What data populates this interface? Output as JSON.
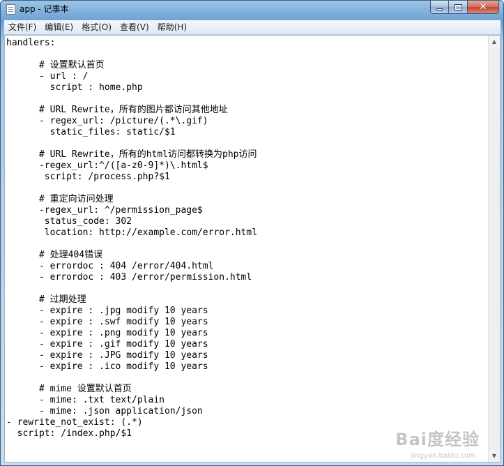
{
  "window": {
    "title": "app - 记事本",
    "icon": "notepad-icon",
    "controls": {
      "minimize": "minimize-icon",
      "maximize": "maximize-icon",
      "close": "close-icon"
    }
  },
  "menu": {
    "items": [
      {
        "label": "文件(F)"
      },
      {
        "label": "编辑(E)"
      },
      {
        "label": "格式(O)"
      },
      {
        "label": "查看(V)"
      },
      {
        "label": "帮助(H)"
      }
    ]
  },
  "editor": {
    "content": "handlers:\n\n      # 设置默认首页\n      - url : /\n        script : home.php\n\n      # URL Rewrite，所有的图片都访问其他地址\n      - regex_url: /picture/(.*\\.gif)\n        static_files: static/$1\n\n      # URL Rewrite，所有的html访问都转换为php访问\n      -regex_url:^/([a-z0-9]*)\\.html$\n       script: /process.php?$1\n\n      # 重定向访问处理\n      -regex_url: ^/permission_page$\n       status_code: 302\n       location: http://example.com/error.html\n\n      # 处理404错误\n      - errordoc : 404 /error/404.html\n      - errordoc : 403 /error/permission.html\n\n      # 过期处理\n      - expire : .jpg modify 10 years\n      - expire : .swf modify 10 years\n      - expire : .png modify 10 years\n      - expire : .gif modify 10 years\n      - expire : .JPG modify 10 years\n      - expire : .ico modify 10 years\n\n      # mime 设置默认首页\n      - mime: .txt text/plain\n      - mime: .json application/json\n- rewrite_not_exist: (.*)\n  script: /index.php/$1"
  },
  "watermark": {
    "main": "Bai度经验",
    "sub": "jingyan.baidu.com"
  }
}
